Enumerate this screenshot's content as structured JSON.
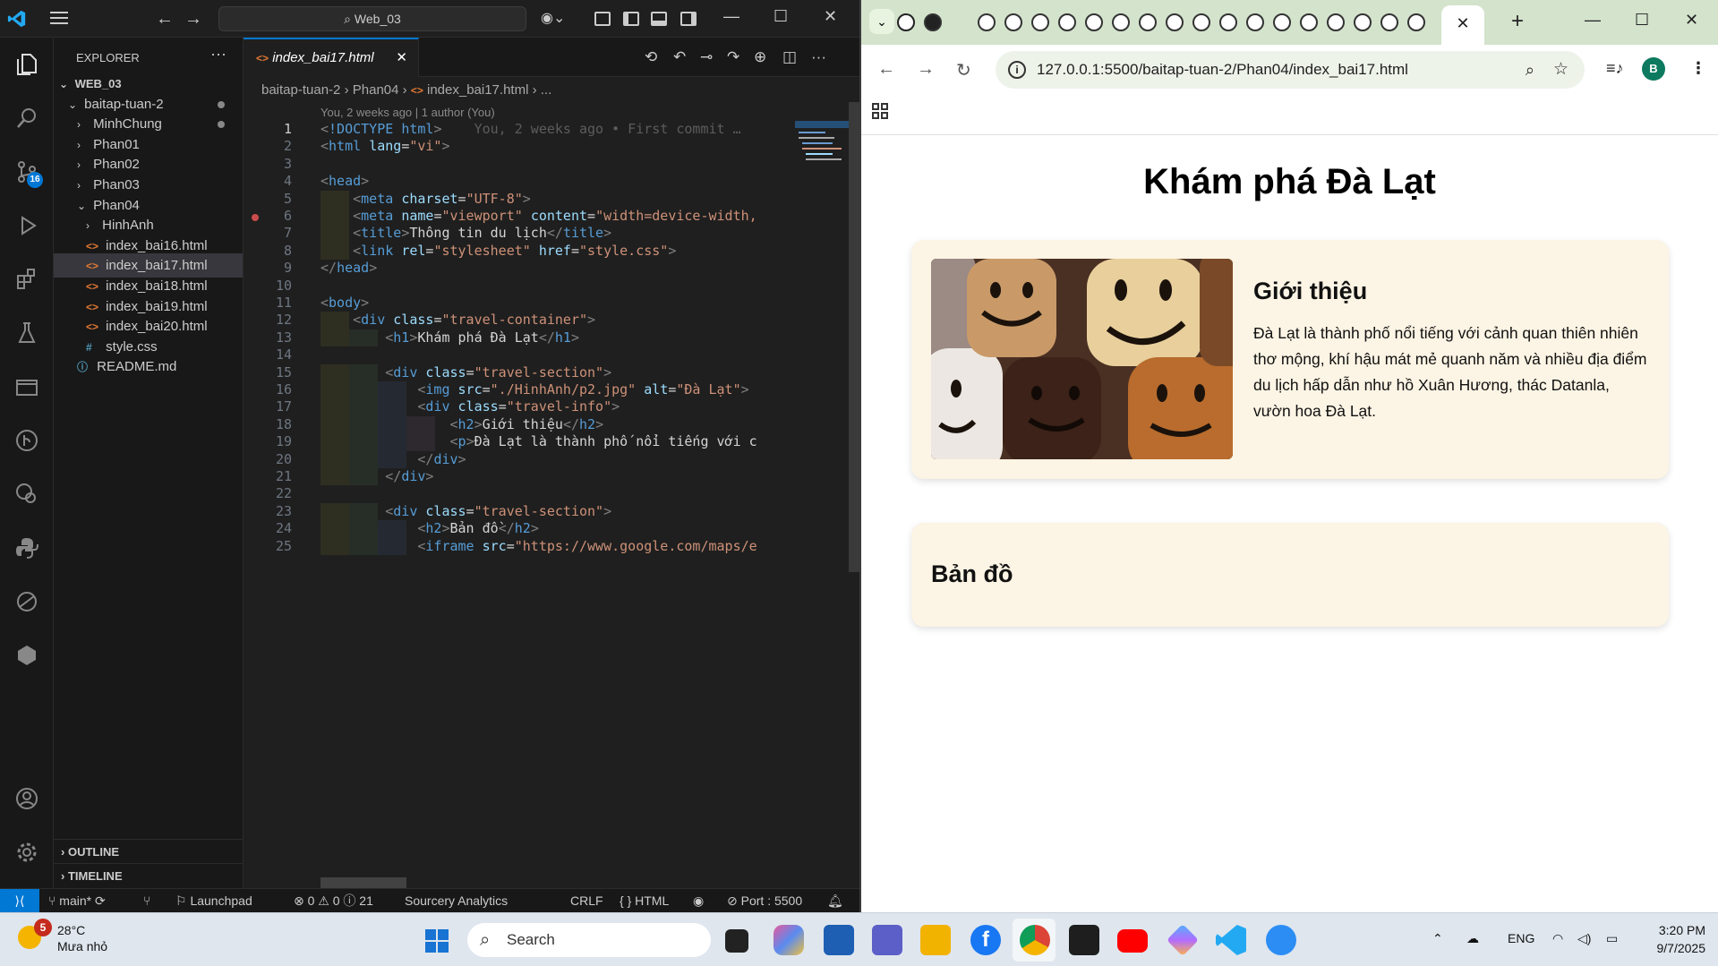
{
  "vscode": {
    "search_text": "Web_03",
    "explorer_title": "EXPLORER",
    "tree": [
      {
        "label": "WEB_03",
        "depth": 0,
        "kind": "root",
        "open": true
      },
      {
        "label": "baitap-tuan-2",
        "depth": 1,
        "kind": "folder",
        "open": true,
        "dot": true
      },
      {
        "label": "MinhChung",
        "depth": 2,
        "kind": "folder",
        "open": false,
        "dot": true
      },
      {
        "label": "Phan01",
        "depth": 2,
        "kind": "folder",
        "open": false
      },
      {
        "label": "Phan02",
        "depth": 2,
        "kind": "folder",
        "open": false
      },
      {
        "label": "Phan03",
        "depth": 2,
        "kind": "folder",
        "open": false
      },
      {
        "label": "Phan04",
        "depth": 2,
        "kind": "folder",
        "open": true
      },
      {
        "label": "HinhAnh",
        "depth": 3,
        "kind": "folder",
        "open": false
      },
      {
        "label": "index_bai16.html",
        "depth": 3,
        "kind": "html"
      },
      {
        "label": "index_bai17.html",
        "depth": 3,
        "kind": "html",
        "selected": true
      },
      {
        "label": "index_bai18.html",
        "depth": 3,
        "kind": "html"
      },
      {
        "label": "index_bai19.html",
        "depth": 3,
        "kind": "html"
      },
      {
        "label": "index_bai20.html",
        "depth": 3,
        "kind": "html"
      },
      {
        "label": "style.css",
        "depth": 3,
        "kind": "css"
      },
      {
        "label": "README.md",
        "depth": 2,
        "kind": "info"
      }
    ],
    "outline_label": "OUTLINE",
    "timeline_label": "TIMELINE",
    "tab_label": "index_bai17.html",
    "breadcrumb": [
      "baitap-tuan-2",
      "Phan04",
      "index_bai17.html",
      "..."
    ],
    "blame_header": "You, 2 weeks ago | 1 author (You)",
    "ghost_blame": "You, 2 weeks ago • First commit …",
    "scm_badge": "16",
    "code_lines": [
      "<!DOCTYPE html>",
      "<html lang=\"vi\">",
      "",
      "<head>",
      "    <meta charset=\"UTF-8\">",
      "    <meta name=\"viewport\" content=\"width=device-width,",
      "    <title>Thông tin du lịch</title>",
      "    <link rel=\"stylesheet\" href=\"style.css\">",
      "</head>",
      "",
      "<body>",
      "    <div class=\"travel-container\">",
      "        <h1>Khám phá Đà Lạt</h1>",
      "",
      "        <div class=\"travel-section\">",
      "            <img src=\"./HinhAnh/p2.jpg\" alt=\"Đà Lạt\">",
      "            <div class=\"travel-info\">",
      "                <h2>Giới thiệu</h2>",
      "                <p>Đà Lạt là thành phố nổi tiếng với c",
      "            </div>",
      "        </div>",
      "",
      "        <div class=\"travel-section\">",
      "            <h2>Bản đồ</h2>",
      "            <iframe src=\"https://www.google.com/maps/e"
    ],
    "status": {
      "branch": "main*",
      "launchpad": "Launchpad",
      "problems": "⊗ 0 ⚠ 0 ⓘ 21",
      "analytics": "Sourcery Analytics",
      "eol": "CRLF",
      "language": "{ } HTML",
      "port": "Port : 5500"
    }
  },
  "browser": {
    "url": "127.0.0.1:5500/baitap-tuan-2/Phan04/index_bai17.html",
    "avatar": "B",
    "page": {
      "title": "Khám phá Đà Lạt",
      "section1_heading": "Giới thiệu",
      "section1_text": "Đà Lạt là thành phố nổi tiếng với cảnh quan thiên nhiên thơ mộng, khí hậu mát mẻ quanh năm và nhiều địa điểm du lịch hấp dẫn như hồ Xuân Hương, thác Datanla, vườn hoa Đà Lạt.",
      "section2_heading": "Bản đồ"
    }
  },
  "taskbar": {
    "weather_badge": "5",
    "temperature": "28°C",
    "weather_text": "Mưa nhỏ",
    "search_label": "Search",
    "language": "ENG",
    "time": "3:20 PM",
    "date": "9/7/2025"
  }
}
